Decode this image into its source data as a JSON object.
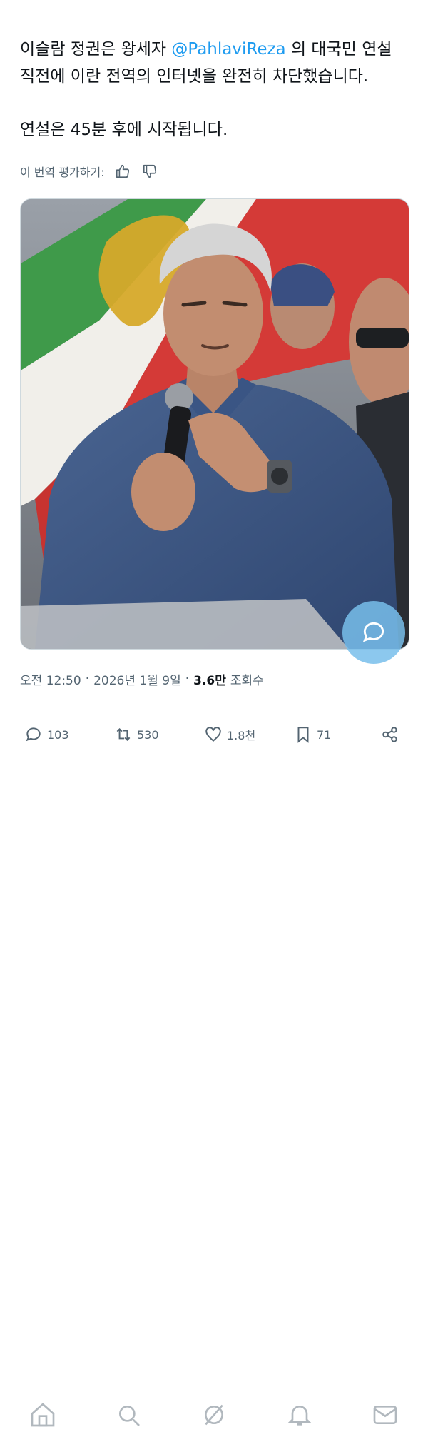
{
  "tweet": {
    "line1_before": "이슬람 정권은 왕세자 ",
    "mention": "@PahlaviReza",
    "line1_after": " 의 대국민 연설",
    "line2": "직전에 이란 전역의 인터넷을 완전히 차단했습니다.",
    "para2": "연설은 45분 후에 시작됩니다."
  },
  "translation": {
    "rate_label": "이 번역 평가하기:",
    "thumbs_up_icon": "thumbs-up-icon",
    "thumbs_down_icon": "thumbs-down-icon"
  },
  "meta": {
    "time": "오전 12:50",
    "separator": "·",
    "date": "2026년 1월 9일",
    "views_count": "3.6만",
    "views_label": "조회수"
  },
  "actions": {
    "replies": "103",
    "retweets": "530",
    "likes": "1.8천",
    "bookmarks": "71"
  },
  "colors": {
    "accent": "#1d9bf0",
    "text": "#0f1419",
    "muted": "#536471"
  }
}
